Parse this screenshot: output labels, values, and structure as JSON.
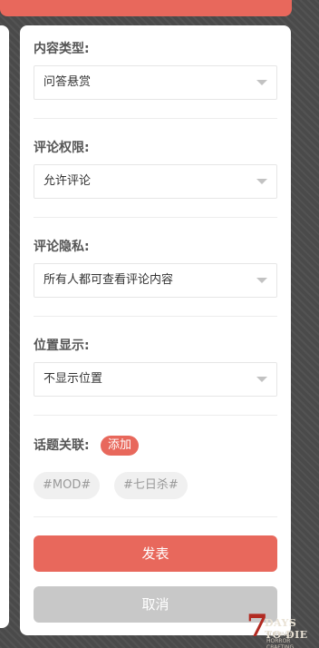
{
  "form": {
    "content_type": {
      "label": "内容类型:",
      "value": "问答悬赏"
    },
    "comment_permission": {
      "label": "评论权限:",
      "value": "允许评论"
    },
    "comment_privacy": {
      "label": "评论隐私:",
      "value": "所有人都可查看评论内容"
    },
    "location_display": {
      "label": "位置显示:",
      "value": "不显示位置"
    },
    "topics": {
      "label": "话题关联:",
      "add_label": "添加",
      "tags": [
        "#MOD#",
        "#七日杀#"
      ]
    },
    "submit_label": "发表",
    "cancel_label": "取消"
  },
  "watermark": {
    "seven": "7",
    "text": "DAYS TO DIE",
    "subtext": "SURVIVAL HORROR CRAFTING"
  },
  "colors": {
    "accent": "#e8685c",
    "cancel": "#c8c8c8",
    "background": "#4a4a4a"
  }
}
